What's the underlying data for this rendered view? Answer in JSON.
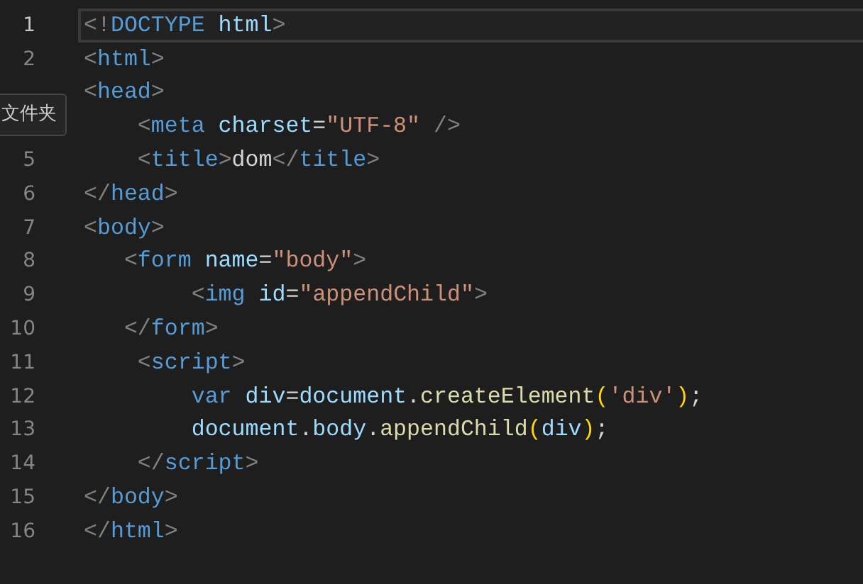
{
  "editor": {
    "lines": [
      {
        "number": "1",
        "selected": true,
        "tokens": [
          {
            "kind": "punct",
            "text": "<!"
          },
          {
            "kind": "tag",
            "text": "DOCTYPE"
          },
          {
            "kind": "attr",
            "text": " html"
          },
          {
            "kind": "punct",
            "text": ">"
          }
        ]
      },
      {
        "number": "2",
        "selected": false,
        "tokens": [
          {
            "kind": "punct",
            "text": "<"
          },
          {
            "kind": "tag",
            "text": "html"
          },
          {
            "kind": "punct",
            "text": ">"
          }
        ]
      },
      {
        "selected": false,
        "tokens": [
          {
            "kind": "punct",
            "text": "<"
          },
          {
            "kind": "tag",
            "text": "head"
          },
          {
            "kind": "punct",
            "text": ">"
          }
        ]
      },
      {
        "selected": false,
        "tokens": [
          {
            "kind": "punct",
            "text": "    <"
          },
          {
            "kind": "tag",
            "text": "meta"
          },
          {
            "kind": "attr",
            "text": " charset"
          },
          {
            "kind": "plain",
            "text": "="
          },
          {
            "kind": "string",
            "text": "\"UTF-8\""
          },
          {
            "kind": "punct",
            "text": " />"
          }
        ]
      },
      {
        "number": "5",
        "selected": false,
        "tokens": [
          {
            "kind": "punct",
            "text": "    <"
          },
          {
            "kind": "tag",
            "text": "title"
          },
          {
            "kind": "punct",
            "text": ">"
          },
          {
            "kind": "plain",
            "text": "dom"
          },
          {
            "kind": "punct",
            "text": "</"
          },
          {
            "kind": "tag",
            "text": "title"
          },
          {
            "kind": "punct",
            "text": ">"
          }
        ]
      },
      {
        "number": "6",
        "selected": false,
        "tokens": [
          {
            "kind": "punct",
            "text": "</"
          },
          {
            "kind": "tag",
            "text": "head"
          },
          {
            "kind": "punct",
            "text": ">"
          }
        ]
      },
      {
        "number": "7",
        "selected": false,
        "tokens": [
          {
            "kind": "punct",
            "text": "<"
          },
          {
            "kind": "tag",
            "text": "body"
          },
          {
            "kind": "punct",
            "text": ">"
          }
        ]
      },
      {
        "number": "8",
        "selected": false,
        "tokens": [
          {
            "kind": "punct",
            "text": "   <"
          },
          {
            "kind": "tag",
            "text": "form"
          },
          {
            "kind": "attr",
            "text": " name"
          },
          {
            "kind": "plain",
            "text": "="
          },
          {
            "kind": "string",
            "text": "\"body\""
          },
          {
            "kind": "punct",
            "text": ">"
          }
        ]
      },
      {
        "number": "9",
        "selected": false,
        "tokens": [
          {
            "kind": "punct",
            "text": "        <"
          },
          {
            "kind": "tag",
            "text": "img"
          },
          {
            "kind": "attr",
            "text": " id"
          },
          {
            "kind": "plain",
            "text": "="
          },
          {
            "kind": "string",
            "text": "\"appendChild\""
          },
          {
            "kind": "punct",
            "text": ">"
          }
        ]
      },
      {
        "number": "10",
        "selected": false,
        "tokens": [
          {
            "kind": "punct",
            "text": "   </"
          },
          {
            "kind": "tag",
            "text": "form"
          },
          {
            "kind": "punct",
            "text": ">"
          }
        ]
      },
      {
        "number": "11",
        "selected": false,
        "tokens": [
          {
            "kind": "punct",
            "text": "    <"
          },
          {
            "kind": "tag",
            "text": "script"
          },
          {
            "kind": "punct",
            "text": ">"
          }
        ]
      },
      {
        "number": "12",
        "selected": false,
        "tokens": [
          {
            "kind": "keyword",
            "text": "        var"
          },
          {
            "kind": "variable",
            "text": " div"
          },
          {
            "kind": "plain",
            "text": "="
          },
          {
            "kind": "variable",
            "text": "document"
          },
          {
            "kind": "plain",
            "text": "."
          },
          {
            "kind": "function",
            "text": "createElement"
          },
          {
            "kind": "paren",
            "text": "("
          },
          {
            "kind": "string",
            "text": "'div'"
          },
          {
            "kind": "paren",
            "text": ")"
          },
          {
            "kind": "plain",
            "text": ";"
          }
        ]
      },
      {
        "number": "13",
        "selected": false,
        "tokens": [
          {
            "kind": "variable",
            "text": "        document"
          },
          {
            "kind": "plain",
            "text": "."
          },
          {
            "kind": "variable",
            "text": "body"
          },
          {
            "kind": "plain",
            "text": "."
          },
          {
            "kind": "function",
            "text": "appendChild"
          },
          {
            "kind": "paren",
            "text": "("
          },
          {
            "kind": "variable",
            "text": "div"
          },
          {
            "kind": "paren",
            "text": ")"
          },
          {
            "kind": "plain",
            "text": ";"
          }
        ]
      },
      {
        "number": "14",
        "selected": false,
        "tokens": [
          {
            "kind": "punct",
            "text": "    </"
          },
          {
            "kind": "tag",
            "text": "script"
          },
          {
            "kind": "punct",
            "text": ">"
          }
        ]
      },
      {
        "number": "15",
        "selected": false,
        "tokens": [
          {
            "kind": "punct",
            "text": "</"
          },
          {
            "kind": "tag",
            "text": "body"
          },
          {
            "kind": "punct",
            "text": ">"
          }
        ]
      },
      {
        "number": "16",
        "selected": false,
        "tokens": [
          {
            "kind": "punct",
            "text": "</"
          },
          {
            "kind": "tag",
            "text": "html"
          },
          {
            "kind": "punct",
            "text": ">"
          }
        ]
      }
    ]
  },
  "tooltip": {
    "text": "文件夹"
  }
}
